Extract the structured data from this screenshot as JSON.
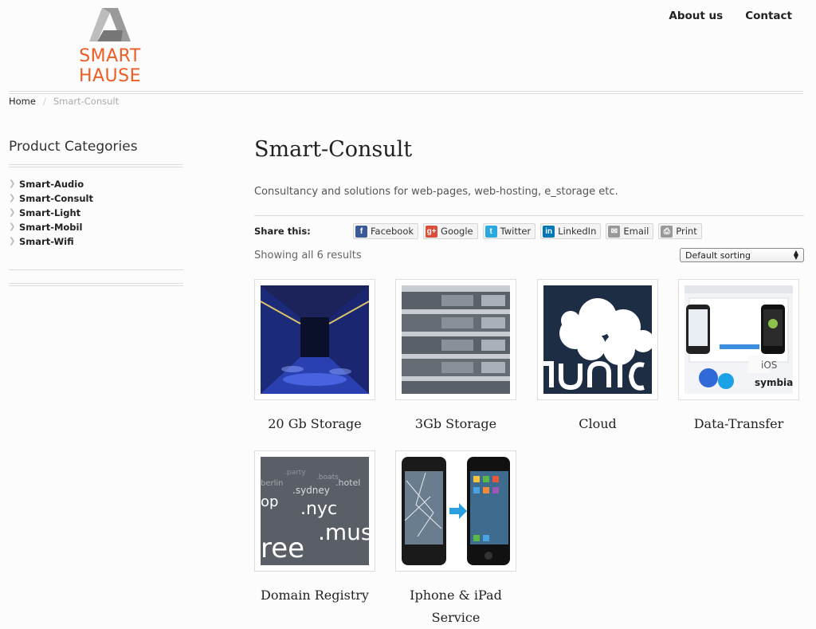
{
  "brand": {
    "name": "SMART HAUSE",
    "accent": "#ee5d23"
  },
  "nav": {
    "items": [
      "About us",
      "Contact"
    ]
  },
  "breadcrumb": {
    "home": "Home",
    "separator": "/",
    "current": "Smart-Consult"
  },
  "sidebar": {
    "title": "Product Categories",
    "categories": [
      "Smart-Audio",
      "Smart-Consult",
      "Smart-Light",
      "Smart-Mobil",
      "Smart-Wifi"
    ]
  },
  "main": {
    "title": "Smart-Consult",
    "description": "Consultancy and solutions for web-pages, web-hosting, e_storage etc.",
    "share": {
      "label": "Share this:",
      "buttons": [
        {
          "label": "Facebook",
          "icon": "facebook-icon",
          "color": "#3b5998"
        },
        {
          "label": "Google",
          "icon": "google-plus-icon",
          "color": "#dd4b39"
        },
        {
          "label": "Twitter",
          "icon": "twitter-icon",
          "color": "#2aa9e0"
        },
        {
          "label": "LinkedIn",
          "icon": "linkedin-icon",
          "color": "#0077b5"
        },
        {
          "label": "Email",
          "icon": "email-icon",
          "color": "#888888"
        },
        {
          "label": "Print",
          "icon": "print-icon",
          "color": "#888888"
        }
      ]
    },
    "results": "Showing all 6 results",
    "sort": {
      "selected": "Default sorting"
    }
  },
  "products": [
    {
      "title": "20 Gb Storage",
      "image": "datacenter-corridor-image"
    },
    {
      "title": "3Gb Storage",
      "image": "server-rack-image"
    },
    {
      "title": "Cloud",
      "image": "owncloud-logo-image"
    },
    {
      "title": "Data-Transfer",
      "image": "data-transfer-screenshot-image"
    },
    {
      "title": "Domain Registry",
      "image": "domain-names-image"
    },
    {
      "title": "Iphone & iPad Service",
      "image": "broken-iphone-repair-image"
    }
  ]
}
